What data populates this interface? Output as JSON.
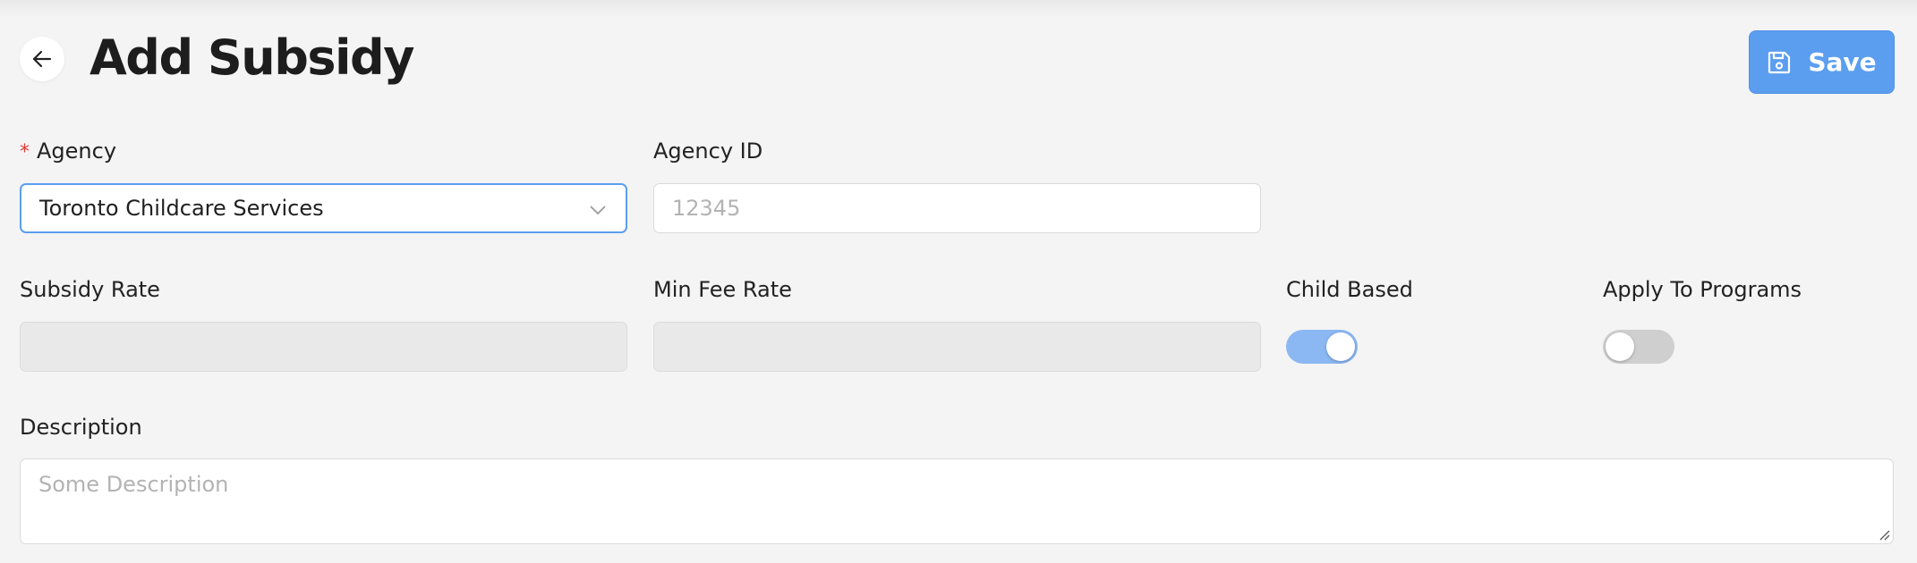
{
  "header": {
    "title": "Add Subsidy",
    "save_label": "Save",
    "back_icon": "arrow-left-icon",
    "save_icon": "floppy-disk-icon"
  },
  "form": {
    "agency": {
      "label": "Agency",
      "required_marker": "*",
      "value": "Toronto Childcare Services"
    },
    "agency_id": {
      "label": "Agency ID",
      "placeholder": "12345"
    },
    "subsidy_rate": {
      "label": "Subsidy Rate",
      "value": ""
    },
    "min_fee_rate": {
      "label": "Min Fee Rate",
      "value": ""
    },
    "child_based": {
      "label": "Child Based",
      "on": true
    },
    "apply_to_programs": {
      "label": "Apply To Programs",
      "on": false
    },
    "description": {
      "label": "Description",
      "placeholder": "Some Description"
    }
  },
  "colors": {
    "accent": "#5b9ef0",
    "toggle_on": "#8bb7f3",
    "toggle_off": "#cfcfcf",
    "required": "#e53935",
    "background": "#f4f4f4"
  }
}
